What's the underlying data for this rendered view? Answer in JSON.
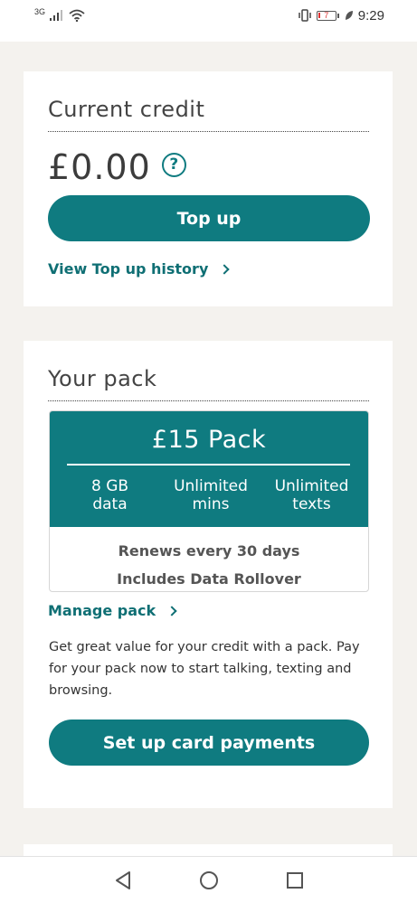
{
  "status_bar": {
    "network": "3G",
    "battery": "7",
    "time": "9:29",
    "icons": [
      "signal-icon",
      "wifi-icon",
      "vibrate-icon",
      "battery-icon",
      "leaf-icon"
    ]
  },
  "credit_card": {
    "title": "Current credit",
    "balance": "£0.00",
    "help_icon": "?",
    "top_up_button": "Top up",
    "history_link": "View Top up history"
  },
  "pack_card": {
    "title": "Your pack",
    "pack_name": "£15 Pack",
    "stats": [
      {
        "line1": "8 GB",
        "line2": "data"
      },
      {
        "line1": "Unlimited",
        "line2": "mins"
      },
      {
        "line1": "Unlimited",
        "line2": "texts"
      }
    ],
    "renews": "Renews every 30 days",
    "rollover": "Includes Data Rollover",
    "manage_link": "Manage pack",
    "description": "Get great value for your credit with a pack. Pay for your pack now to start talking, texting and browsing.",
    "card_payments_button": "Set up card payments"
  },
  "colors": {
    "accent": "#0f7b80",
    "background": "#f4f2ee"
  }
}
